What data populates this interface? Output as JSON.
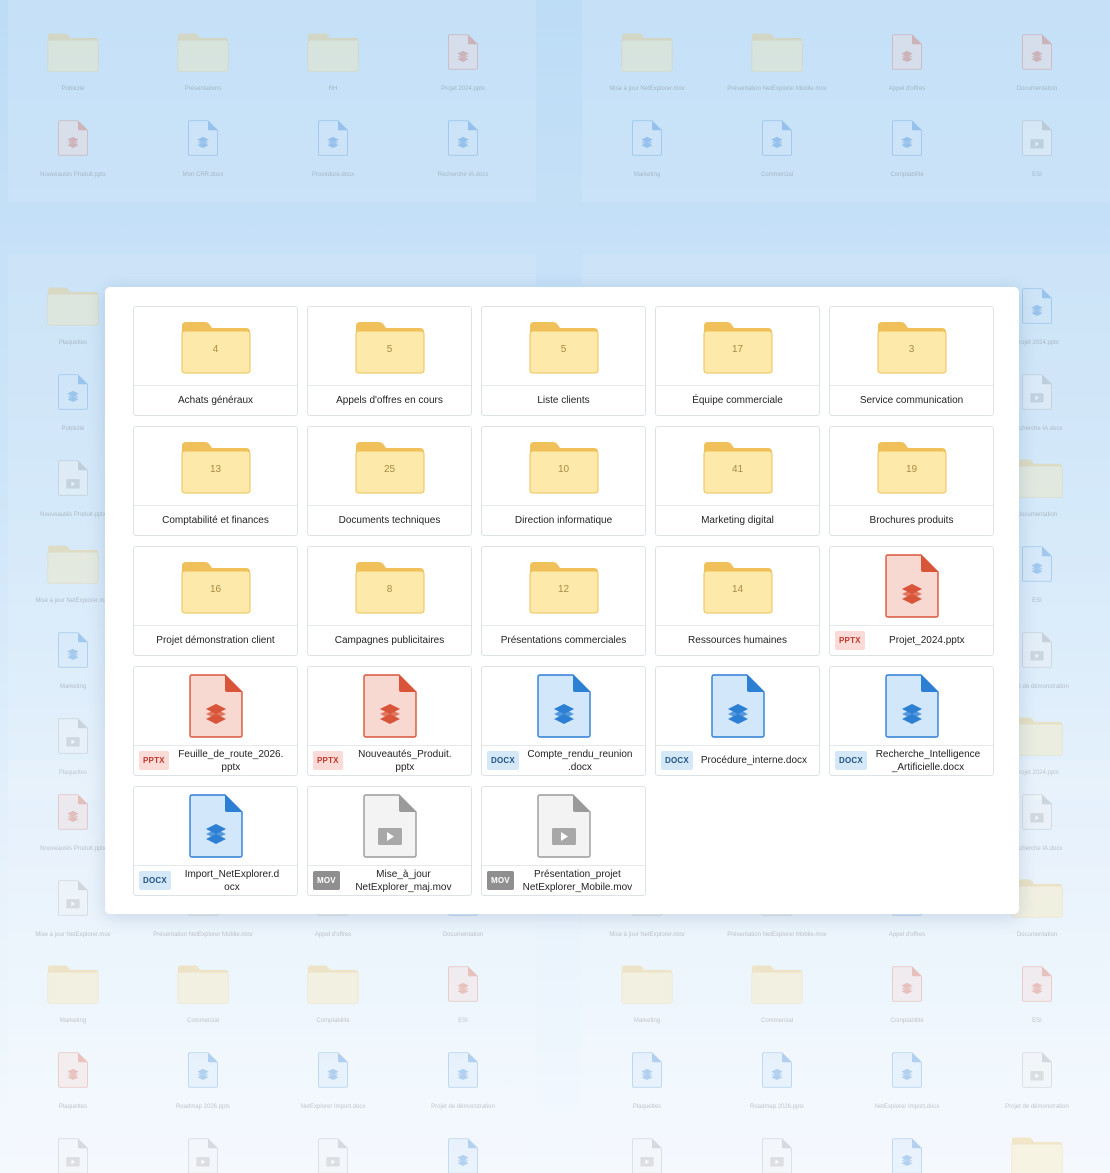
{
  "items": [
    {
      "kind": "folder",
      "name": "Achats généraux",
      "count": "4"
    },
    {
      "kind": "folder",
      "name": "Appels d'offres en cours",
      "count": "5"
    },
    {
      "kind": "folder",
      "name": "Liste clients",
      "count": "5"
    },
    {
      "kind": "folder",
      "name": "Équipe commerciale",
      "count": "17"
    },
    {
      "kind": "folder",
      "name": "Service communication",
      "count": "3"
    },
    {
      "kind": "folder",
      "name": "Comptabilité et finances",
      "count": "13"
    },
    {
      "kind": "folder",
      "name": "Documents techniques",
      "count": "25"
    },
    {
      "kind": "folder",
      "name": "Direction informatique",
      "count": "10"
    },
    {
      "kind": "folder",
      "name": "Marketing digital",
      "count": "41"
    },
    {
      "kind": "folder",
      "name": "Brochures produits",
      "count": "19"
    },
    {
      "kind": "folder",
      "name": "Projet démonstration client",
      "count": "16"
    },
    {
      "kind": "folder",
      "name": "Campagnes publicitaires",
      "count": "8"
    },
    {
      "kind": "folder",
      "name": "Présentations commerciales",
      "count": "12"
    },
    {
      "kind": "folder",
      "name": "Ressources humaines",
      "count": "14"
    },
    {
      "kind": "pptx",
      "badge": "PPTX",
      "name": "Projet_2024.pptx"
    },
    {
      "kind": "pptx",
      "badge": "PPTX",
      "name": "Feuille_de_route_2026.\npptx"
    },
    {
      "kind": "pptx",
      "badge": "PPTX",
      "name": "Nouveautés_Produit.\npptx"
    },
    {
      "kind": "docx",
      "badge": "DOCX",
      "name": "Compte_rendu_reunion\n.docx"
    },
    {
      "kind": "docx",
      "badge": "DOCX",
      "name": "Procédure_interne.docx"
    },
    {
      "kind": "docx",
      "badge": "DOCX",
      "name": "Recherche_Intelligence\n_Artificielle.docx"
    },
    {
      "kind": "docx",
      "badge": "DOCX",
      "name": "Import_NetExplorer.d\nocx"
    },
    {
      "kind": "mov",
      "badge": "MOV",
      "name": "Mise_à_jour\nNetExplorer_maj.mov"
    },
    {
      "kind": "mov",
      "badge": "MOV",
      "name": "Présentation_projet\nNetExplorer_Mobile.mov"
    }
  ],
  "background": {
    "labels": [
      "Publicité",
      "Présentations",
      "RH",
      "Projet 2024.pptx",
      "Nouveautés Produit.pptx",
      "Mon CRR.docx",
      "Procédure.docx",
      "Recherche IA.docx",
      "Mise à jour NetExplorer.mov",
      "Présentation NetExplorer Mobile.mov",
      "Appel d'offres",
      "Documentation",
      "Marketing",
      "Commercial",
      "Comptabilité",
      "ESI",
      "Plaquettes",
      "Roadmap 2026.pptx",
      "NetExplorer Import.docx",
      "Projet de démonstration"
    ]
  },
  "colors": {
    "folder_back": "#f0c15a",
    "folder_front": "#fde9a9",
    "pptx_accent": "#d9553a",
    "pptx_fill": "#f8d9d2",
    "docx_accent": "#2d7fd3",
    "docx_fill": "#d3e7fa",
    "mov_accent": "#9a9a9a",
    "mov_fill": "#f3f3f3"
  }
}
